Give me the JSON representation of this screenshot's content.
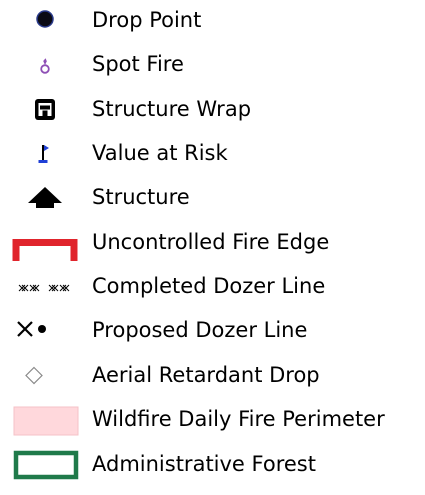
{
  "legend": {
    "items": [
      {
        "label": "Drop Point",
        "icon": "drop-point-icon",
        "color": "#0a0a14"
      },
      {
        "label": "Spot Fire",
        "icon": "spot-fire-icon",
        "color": "#8e4fb5"
      },
      {
        "label": "Structure Wrap",
        "icon": "structure-wrap-icon",
        "color": "#000000"
      },
      {
        "label": "Value at Risk",
        "icon": "value-at-risk-icon",
        "color": "#1f3fd6"
      },
      {
        "label": "Structure",
        "icon": "structure-icon",
        "color": "#000000"
      },
      {
        "label": "Uncontrolled Fire Edge",
        "icon": "uncontrolled-fire-edge-icon",
        "color": "#e0242c"
      },
      {
        "label": "Completed Dozer Line",
        "icon": "completed-dozer-line-icon",
        "color": "#000000"
      },
      {
        "label": "Proposed Dozer Line",
        "icon": "proposed-dozer-line-icon",
        "color": "#000000"
      },
      {
        "label": "Aerial Retardant Drop",
        "icon": "aerial-retardant-drop-icon",
        "color": "#8a8a8a"
      },
      {
        "label": "Wildfire Daily Fire Perimeter",
        "icon": "wildfire-daily-fire-perimeter-icon",
        "color": "#ffd8dc"
      },
      {
        "label": "Administrative Forest",
        "icon": "administrative-forest-icon",
        "color": "#1f7a4a"
      }
    ]
  }
}
